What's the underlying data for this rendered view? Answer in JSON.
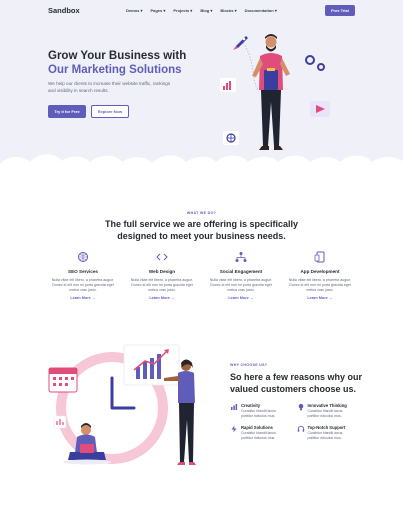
{
  "nav": {
    "brand": "Sandbox",
    "menu": [
      "Demos",
      "Pages",
      "Projects",
      "Blog",
      "Blocks",
      "Documentation"
    ],
    "cta": "Free Trial"
  },
  "hero": {
    "title_line1": "Grow Your Business with",
    "title_line2": "Our Marketing Solutions",
    "subtitle": "We help our clients to increase their website traffic, rankings and visibility in search results.",
    "primary_button": "Try it for Free",
    "secondary_button": "Explore Now"
  },
  "services_section": {
    "eyebrow": "WHAT WE DO?",
    "title": "The full service we are offering is specifically designed to meet your business needs.",
    "items": [
      {
        "icon": "globe-icon",
        "name": "SEO Services",
        "desc": "Nulla vitae elit libero, a pharetra augue. Donec id elit non mi porta gravida eget metus cras justo.",
        "link": "Learn More"
      },
      {
        "icon": "code-icon",
        "name": "Web Design",
        "desc": "Nulla vitae elit libero, a pharetra augue. Donec id elit non mi porta gravida eget metus cras justo.",
        "link": "Learn More"
      },
      {
        "icon": "network-icon",
        "name": "Social Engagement",
        "desc": "Nulla vitae elit libero, a pharetra augue. Donec id elit non mi porta gravida eget metus cras justo.",
        "link": "Learn More"
      },
      {
        "icon": "devices-icon",
        "name": "App Development",
        "desc": "Nulla vitae elit libero, a pharetra augue. Donec id elit non mi porta gravida eget metus cras justo.",
        "link": "Learn More"
      }
    ]
  },
  "why_section": {
    "eyebrow": "WHY CHOOSE US?",
    "title": "So here a few reasons why our valued customers choose us.",
    "reasons": [
      {
        "icon": "chart-icon",
        "name": "Creativity",
        "desc": "Curabitur blandit lacus porttitor ridiculus mus."
      },
      {
        "icon": "lightbulb-icon",
        "name": "Innovative Thinking",
        "desc": "Curabitur blandit lacus porttitor ridiculus mus."
      },
      {
        "icon": "bolt-icon",
        "name": "Rapid Solutions",
        "desc": "Curabitur blandit lacus porttitor ridiculus mus."
      },
      {
        "icon": "headset-icon",
        "name": "Top-Notch Support",
        "desc": "Curabitur blandit lacus porttitor ridiculus mus."
      }
    ]
  },
  "colors": {
    "accent": "#605dba",
    "hero_bg": "#f0f0f8",
    "heading": "#262b32",
    "body_text": "#60697b",
    "pink": "#e04d7a"
  }
}
